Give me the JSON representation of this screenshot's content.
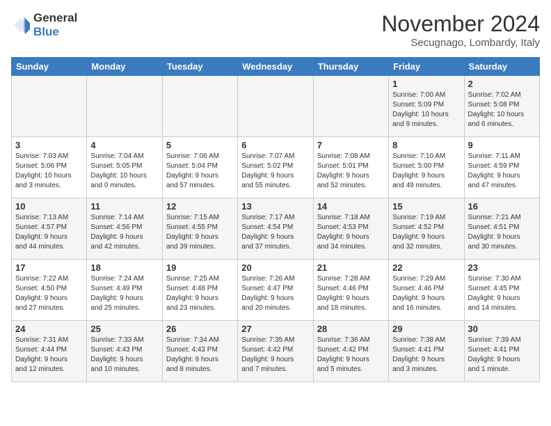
{
  "logo": {
    "line1": "General",
    "line2": "Blue"
  },
  "title": "November 2024",
  "location": "Secugnago, Lombardy, Italy",
  "weekdays": [
    "Sunday",
    "Monday",
    "Tuesday",
    "Wednesday",
    "Thursday",
    "Friday",
    "Saturday"
  ],
  "weeks": [
    [
      {
        "day": "",
        "info": ""
      },
      {
        "day": "",
        "info": ""
      },
      {
        "day": "",
        "info": ""
      },
      {
        "day": "",
        "info": ""
      },
      {
        "day": "",
        "info": ""
      },
      {
        "day": "1",
        "info": "Sunrise: 7:00 AM\nSunset: 5:09 PM\nDaylight: 10 hours\nand 9 minutes."
      },
      {
        "day": "2",
        "info": "Sunrise: 7:02 AM\nSunset: 5:08 PM\nDaylight: 10 hours\nand 6 minutes."
      }
    ],
    [
      {
        "day": "3",
        "info": "Sunrise: 7:03 AM\nSunset: 5:06 PM\nDaylight: 10 hours\nand 3 minutes."
      },
      {
        "day": "4",
        "info": "Sunrise: 7:04 AM\nSunset: 5:05 PM\nDaylight: 10 hours\nand 0 minutes."
      },
      {
        "day": "5",
        "info": "Sunrise: 7:06 AM\nSunset: 5:04 PM\nDaylight: 9 hours\nand 57 minutes."
      },
      {
        "day": "6",
        "info": "Sunrise: 7:07 AM\nSunset: 5:02 PM\nDaylight: 9 hours\nand 55 minutes."
      },
      {
        "day": "7",
        "info": "Sunrise: 7:08 AM\nSunset: 5:01 PM\nDaylight: 9 hours\nand 52 minutes."
      },
      {
        "day": "8",
        "info": "Sunrise: 7:10 AM\nSunset: 5:00 PM\nDaylight: 9 hours\nand 49 minutes."
      },
      {
        "day": "9",
        "info": "Sunrise: 7:11 AM\nSunset: 4:59 PM\nDaylight: 9 hours\nand 47 minutes."
      }
    ],
    [
      {
        "day": "10",
        "info": "Sunrise: 7:13 AM\nSunset: 4:57 PM\nDaylight: 9 hours\nand 44 minutes."
      },
      {
        "day": "11",
        "info": "Sunrise: 7:14 AM\nSunset: 4:56 PM\nDaylight: 9 hours\nand 42 minutes."
      },
      {
        "day": "12",
        "info": "Sunrise: 7:15 AM\nSunset: 4:55 PM\nDaylight: 9 hours\nand 39 minutes."
      },
      {
        "day": "13",
        "info": "Sunrise: 7:17 AM\nSunset: 4:54 PM\nDaylight: 9 hours\nand 37 minutes."
      },
      {
        "day": "14",
        "info": "Sunrise: 7:18 AM\nSunset: 4:53 PM\nDaylight: 9 hours\nand 34 minutes."
      },
      {
        "day": "15",
        "info": "Sunrise: 7:19 AM\nSunset: 4:52 PM\nDaylight: 9 hours\nand 32 minutes."
      },
      {
        "day": "16",
        "info": "Sunrise: 7:21 AM\nSunset: 4:51 PM\nDaylight: 9 hours\nand 30 minutes."
      }
    ],
    [
      {
        "day": "17",
        "info": "Sunrise: 7:22 AM\nSunset: 4:50 PM\nDaylight: 9 hours\nand 27 minutes."
      },
      {
        "day": "18",
        "info": "Sunrise: 7:24 AM\nSunset: 4:49 PM\nDaylight: 9 hours\nand 25 minutes."
      },
      {
        "day": "19",
        "info": "Sunrise: 7:25 AM\nSunset: 4:48 PM\nDaylight: 9 hours\nand 23 minutes."
      },
      {
        "day": "20",
        "info": "Sunrise: 7:26 AM\nSunset: 4:47 PM\nDaylight: 9 hours\nand 20 minutes."
      },
      {
        "day": "21",
        "info": "Sunrise: 7:28 AM\nSunset: 4:46 PM\nDaylight: 9 hours\nand 18 minutes."
      },
      {
        "day": "22",
        "info": "Sunrise: 7:29 AM\nSunset: 4:46 PM\nDaylight: 9 hours\nand 16 minutes."
      },
      {
        "day": "23",
        "info": "Sunrise: 7:30 AM\nSunset: 4:45 PM\nDaylight: 9 hours\nand 14 minutes."
      }
    ],
    [
      {
        "day": "24",
        "info": "Sunrise: 7:31 AM\nSunset: 4:44 PM\nDaylight: 9 hours\nand 12 minutes."
      },
      {
        "day": "25",
        "info": "Sunrise: 7:33 AM\nSunset: 4:43 PM\nDaylight: 9 hours\nand 10 minutes."
      },
      {
        "day": "26",
        "info": "Sunrise: 7:34 AM\nSunset: 4:43 PM\nDaylight: 9 hours\nand 8 minutes."
      },
      {
        "day": "27",
        "info": "Sunrise: 7:35 AM\nSunset: 4:42 PM\nDaylight: 9 hours\nand 7 minutes."
      },
      {
        "day": "28",
        "info": "Sunrise: 7:36 AM\nSunset: 4:42 PM\nDaylight: 9 hours\nand 5 minutes."
      },
      {
        "day": "29",
        "info": "Sunrise: 7:38 AM\nSunset: 4:41 PM\nDaylight: 9 hours\nand 3 minutes."
      },
      {
        "day": "30",
        "info": "Sunrise: 7:39 AM\nSunset: 4:41 PM\nDaylight: 9 hours\nand 1 minute."
      }
    ]
  ]
}
